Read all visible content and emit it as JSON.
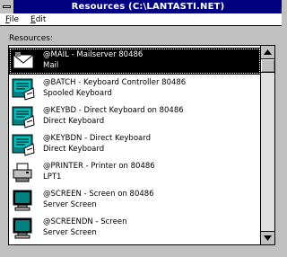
{
  "window": {
    "title": "Resources (C:\\LANTASTI.NET)"
  },
  "menu": [
    {
      "label": "File",
      "accel": "F",
      "rest": "ile"
    },
    {
      "label": "Edit",
      "accel": "E",
      "rest": "dit"
    }
  ],
  "resources_label": "Resources:",
  "items": [
    {
      "name": "@MAIL",
      "description": "Mailserver 80486",
      "type": "Mail",
      "icon": "mail-icon",
      "selected": true
    },
    {
      "name": "@BATCH",
      "description": "Keyboard Controller 80486",
      "type": "Spooled Keyboard",
      "icon": "keyboard-icon",
      "selected": false
    },
    {
      "name": "@KEYBD",
      "description": "Direct Keyboard on 80486",
      "type": "Direct Keyboard",
      "icon": "keyboard-icon",
      "selected": false
    },
    {
      "name": "@KEYBDN",
      "description": "Direct Keyboard",
      "type": "Direct Keyboard",
      "icon": "keyboard-icon",
      "selected": false
    },
    {
      "name": "@PRINTER",
      "description": "Printer on 80486",
      "type": "LPT1",
      "icon": "printer-icon",
      "selected": false
    },
    {
      "name": "@SCREEN",
      "description": "Screen on 80486",
      "type": "Server Screen",
      "icon": "screen-icon",
      "selected": false
    },
    {
      "name": "@SCREENDN",
      "description": "Screen",
      "type": "Server Screen",
      "icon": "screen-icon",
      "selected": false
    }
  ],
  "colors": {
    "titlebar": "#000080",
    "face": "#c0c0c0",
    "selection": "#000000",
    "icon_teal": "#008080"
  }
}
